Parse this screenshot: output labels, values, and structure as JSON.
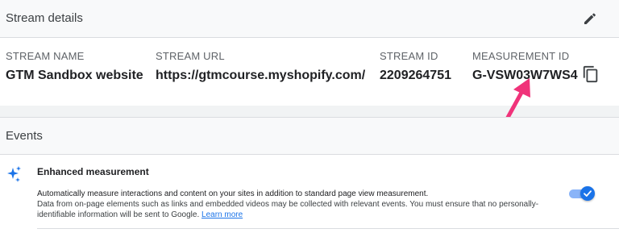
{
  "stream_details": {
    "title": "Stream details",
    "stream_name_label": "STREAM NAME",
    "stream_name": "GTM Sandbox website",
    "stream_url_label": "STREAM URL",
    "stream_url": "https://gtmcourse.myshopify.com/",
    "stream_id_label": "STREAM ID",
    "stream_id": "2209264751",
    "measurement_id_label": "MEASUREMENT ID",
    "measurement_id": "G-VSW03W7WS4",
    "icons": {
      "edit": "pencil-icon",
      "copy": "copy-icon"
    },
    "annotation_arrow_color": "#f0337a"
  },
  "events": {
    "title": "Events",
    "enhanced_measurement": {
      "icon": "sparkle-icon",
      "title": "Enhanced measurement",
      "description_bold": "Automatically measure interactions and content on your sites in addition to standard page view measurement.",
      "description": "Data from on-page elements such as links and embedded videos may be collected with relevant events. You must ensure that no personally-identifiable information will be sent to Google.",
      "learn_more": "Learn more",
      "enabled": true
    }
  }
}
